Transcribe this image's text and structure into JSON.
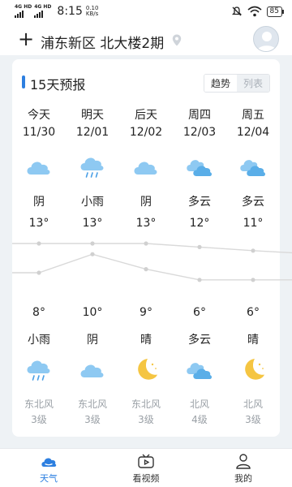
{
  "status_bar": {
    "network_1": "4G HD",
    "network_2": "4G HD",
    "time": "8:15",
    "speed_value": "0.10",
    "speed_unit": "KB/s",
    "battery": "85"
  },
  "header": {
    "add_label": "+",
    "location": "浦东新区 北大楼2期"
  },
  "forecast": {
    "title": "15天预报",
    "toggle_trend": "趋势",
    "toggle_list": "列表",
    "days": [
      {
        "name": "今天",
        "date": "11/30",
        "day_icon": "cloudy-icon",
        "day_cond": "阴",
        "high": "13°",
        "low": "8°",
        "night_cond": "小雨",
        "night_icon": "light-rain-icon",
        "wind_dir": "东北风",
        "wind_level": "3级"
      },
      {
        "name": "明天",
        "date": "12/01",
        "day_icon": "light-rain-icon",
        "day_cond": "小雨",
        "high": "13°",
        "low": "10°",
        "night_cond": "阴",
        "night_icon": "cloudy-icon",
        "wind_dir": "东北风",
        "wind_level": "3级"
      },
      {
        "name": "后天",
        "date": "12/02",
        "day_icon": "cloudy-icon",
        "day_cond": "阴",
        "high": "13°",
        "low": "9°",
        "night_cond": "晴",
        "night_icon": "clear-night-icon",
        "wind_dir": "东北风",
        "wind_level": "3级"
      },
      {
        "name": "周四",
        "date": "12/03",
        "day_icon": "partly-cloudy-icon",
        "day_cond": "多云",
        "high": "12°",
        "low": "6°",
        "night_cond": "多云",
        "night_icon": "partly-cloudy-icon",
        "wind_dir": "北风",
        "wind_level": "4级"
      },
      {
        "name": "周五",
        "date": "12/04",
        "day_icon": "partly-cloudy-icon",
        "day_cond": "多云",
        "high": "11°",
        "low": "6°",
        "night_cond": "晴",
        "night_icon": "clear-night-icon",
        "wind_dir": "北风",
        "wind_level": "3级"
      }
    ],
    "high_values": [
      13,
      13,
      13,
      12,
      11
    ],
    "low_values": [
      8,
      10,
      9,
      6,
      6
    ]
  },
  "nav": {
    "weather": "天气",
    "video": "看视频",
    "me": "我的"
  },
  "colors": {
    "accent": "#2d7fe0",
    "cloud": "#8ec9f2",
    "moon": "#f5c542",
    "trend_line": "#d9d9d9"
  }
}
